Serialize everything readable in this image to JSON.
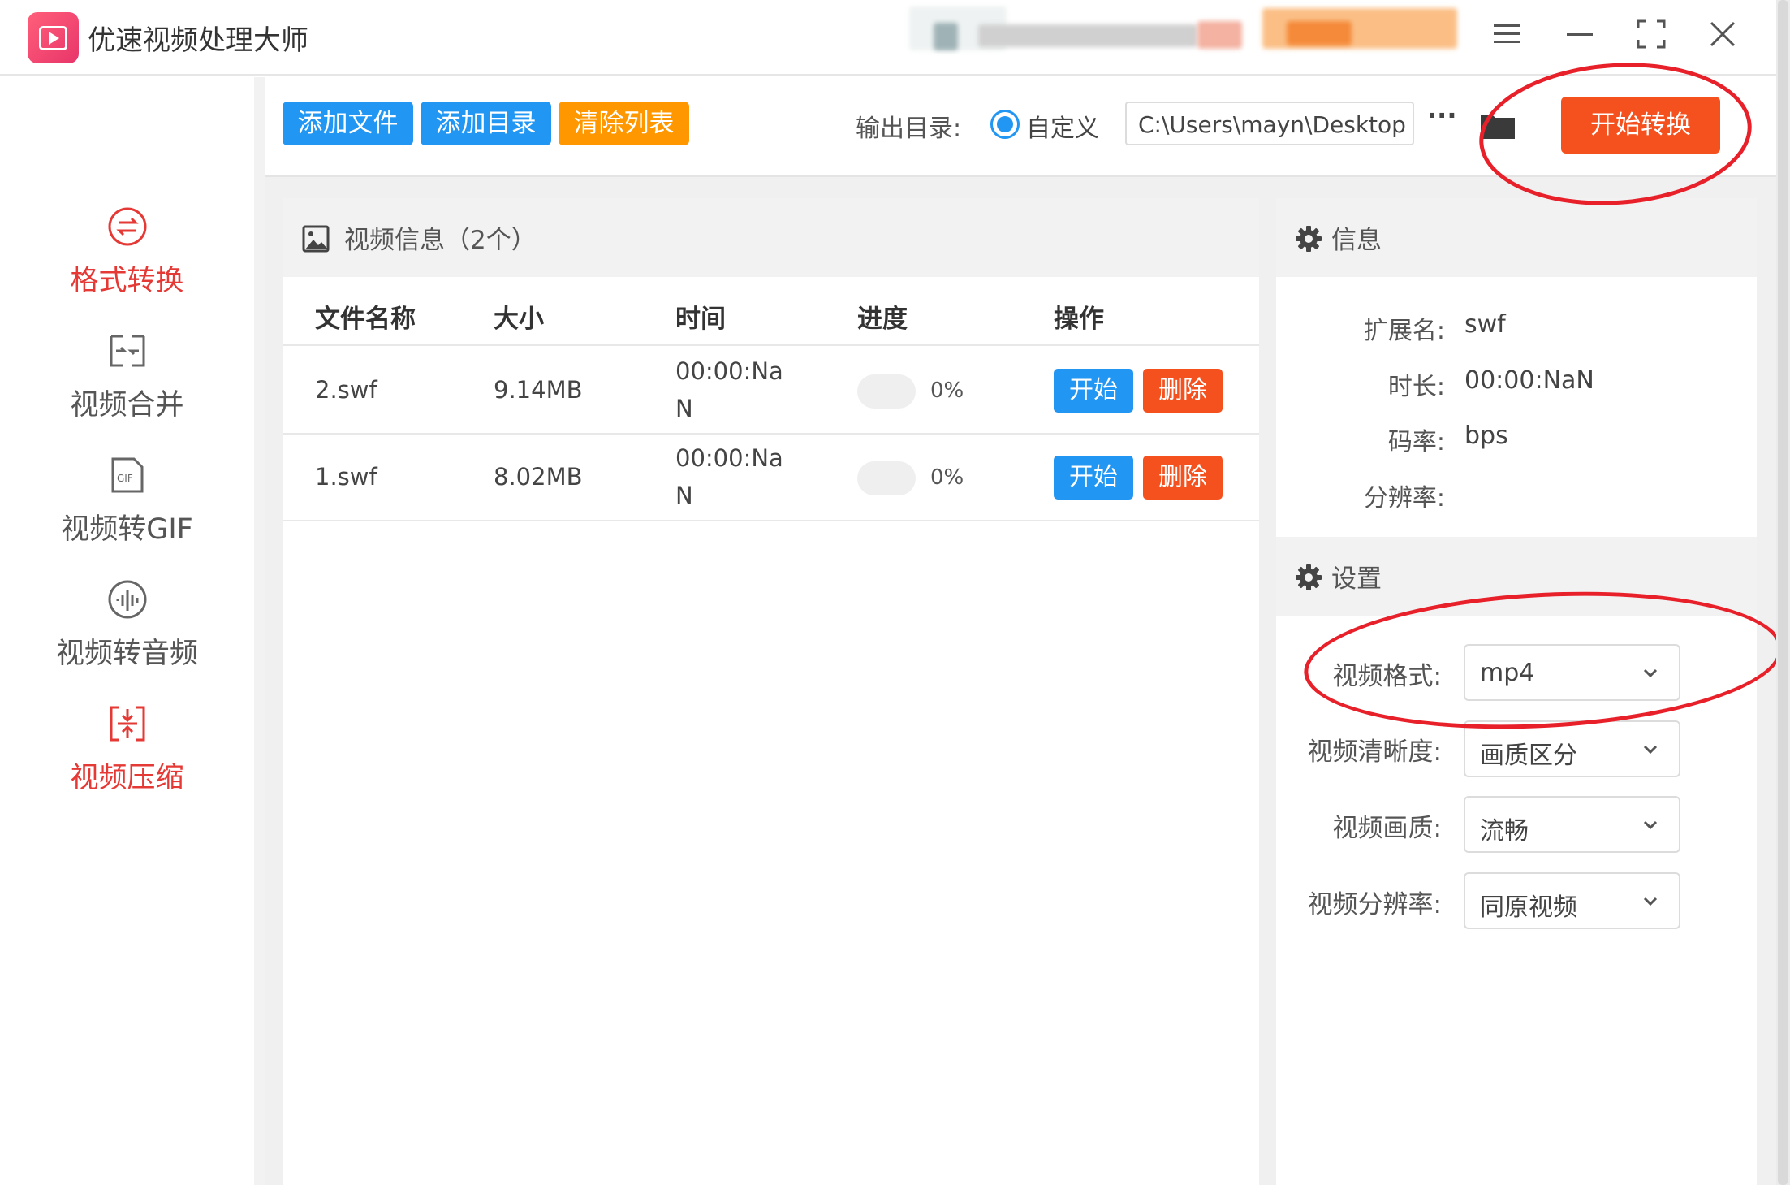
{
  "app": {
    "title": "优速视频处理大师"
  },
  "sidebar": {
    "items": [
      {
        "label": "格式转换",
        "icon": "swap-circle-icon",
        "active": true
      },
      {
        "label": "视频合并",
        "icon": "merge-icon",
        "active": false
      },
      {
        "label": "视频转GIF",
        "icon": "gif-file-icon",
        "active": false
      },
      {
        "label": "视频转音频",
        "icon": "audio-wave-icon",
        "active": false
      },
      {
        "label": "视频压缩",
        "icon": "compress-icon",
        "active": true
      }
    ]
  },
  "toolbar": {
    "add_file": "添加文件",
    "add_dir": "添加目录",
    "clear_list": "清除列表",
    "output_label": "输出目录:",
    "custom_option": "自定义",
    "output_path": "C:\\Users\\mayn\\Desktop",
    "more": "···",
    "start_convert": "开始转换"
  },
  "video_info": {
    "title": "视频信息（2个）",
    "columns": [
      "文件名称",
      "大小",
      "时间",
      "进度",
      "操作"
    ],
    "rows": [
      {
        "name": "2.swf",
        "size": "9.14MB",
        "time_line1": "00:00:Na",
        "time_line2": "N",
        "progress": "0%",
        "start": "开始",
        "delete": "删除"
      },
      {
        "name": "1.swf",
        "size": "8.02MB",
        "time_line1": "00:00:Na",
        "time_line2": "N",
        "progress": "0%",
        "start": "开始",
        "delete": "删除"
      }
    ]
  },
  "info_panel": {
    "title": "信息",
    "fields": [
      {
        "label": "扩展名:",
        "value": "swf"
      },
      {
        "label": "时长:",
        "value": "00:00:NaN"
      },
      {
        "label": "码率:",
        "value": "bps"
      },
      {
        "label": "分辨率:",
        "value": ""
      }
    ]
  },
  "settings_panel": {
    "title": "设置",
    "fields": [
      {
        "label": "视频格式:",
        "value": "mp4"
      },
      {
        "label": "视频清晰度:",
        "value": "画质区分"
      },
      {
        "label": "视频画质:",
        "value": "流畅"
      },
      {
        "label": "视频分辨率:",
        "value": "同原视频"
      }
    ]
  },
  "colors": {
    "accent_blue": "#2196f3",
    "accent_orange": "#ff9800",
    "danger_red": "#f4511e",
    "active_red": "#e53935",
    "annotation_red": "#e8202a"
  }
}
